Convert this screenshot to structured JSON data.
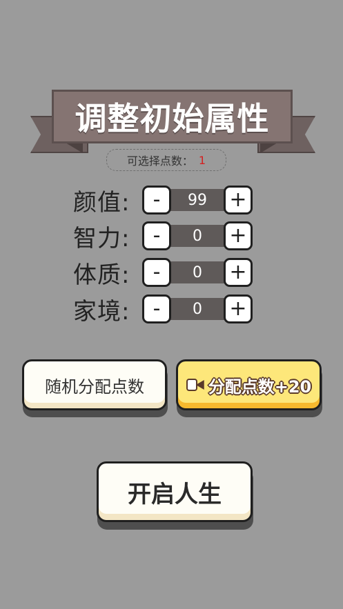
{
  "title": "调整初始属性",
  "points": {
    "label": "可选择点数：",
    "value": "1"
  },
  "attributes": [
    {
      "label": "颜值:",
      "value": "99"
    },
    {
      "label": "智力:",
      "value": "0"
    },
    {
      "label": "体质:",
      "value": "0"
    },
    {
      "label": "家境:",
      "value": "0"
    }
  ],
  "controls": {
    "minus": "-",
    "plus": "+"
  },
  "buttons": {
    "random": "随机分配点数",
    "video_bonus": "分配点数+20",
    "video_icon": "video-camera-icon",
    "start": "开启人生"
  },
  "colors": {
    "background": "#9b9b9b",
    "banner": "#857472",
    "highlight_button": "#fde77a",
    "points_value": "#d42020"
  }
}
